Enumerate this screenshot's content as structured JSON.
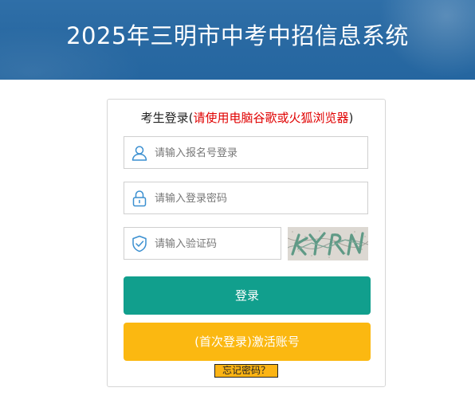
{
  "header": {
    "title": "2025年三明市中考中招信息系统"
  },
  "login": {
    "title_prefix": "考生登录(",
    "title_warning": "请使用电脑谷歌或火狐浏览器",
    "title_suffix": ")",
    "username": {
      "placeholder": "请输入报名号登录",
      "value": "",
      "icon": "user-icon"
    },
    "password": {
      "placeholder": "请输入登录密码",
      "value": "",
      "icon": "lock-icon"
    },
    "captcha": {
      "placeholder": "请输入验证码",
      "value": "",
      "icon": "shield-icon",
      "image_text": "KYRN"
    },
    "login_button": "登录",
    "activate_button": "(首次登录)激活账号",
    "forgot_link": "忘记密码？"
  },
  "colors": {
    "header": "#2a6aa3",
    "login_button": "#119f8d",
    "activate_button": "#fbb811",
    "warning_text": "#e00000"
  }
}
